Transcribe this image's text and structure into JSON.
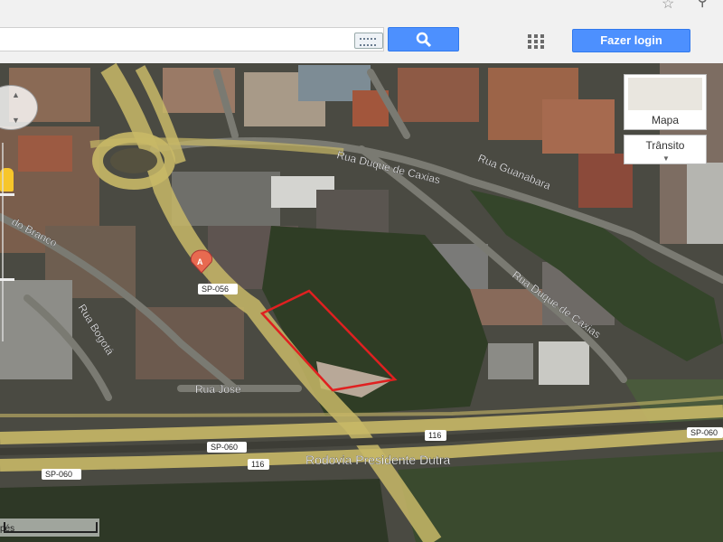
{
  "header": {
    "search_value": "",
    "login_label": "Fazer login",
    "search_icon": "search-icon",
    "apps_icon": "apps-grid-icon",
    "keyboard_icon": "keyboard-icon",
    "star_icon": "star-icon"
  },
  "map": {
    "type_panel_label": "Mapa",
    "traffic_label": "Trânsito",
    "marker_label": "A",
    "scale_label": "pés",
    "road_labels": {
      "duque1": "Rua Duque de Caxias",
      "duque2": "Rua Duque de Caxias",
      "guanabara": "Rua Guanabara",
      "bogota": "Rua Bogotá",
      "branco": "do Branco",
      "jose": "Rua José",
      "dutra": "Rodovia Presidente Dutra",
      "sp056": "SP-056",
      "sp060a": "SP-060",
      "sp060b": "SP-060",
      "sp060c": "SP-060",
      "r116a": "116",
      "r116b": "116"
    },
    "colors": {
      "highway": "#c8b867",
      "parcel_outline": "#e02020",
      "marker": "#e86a50",
      "vegetation": "#2f3d25"
    }
  }
}
